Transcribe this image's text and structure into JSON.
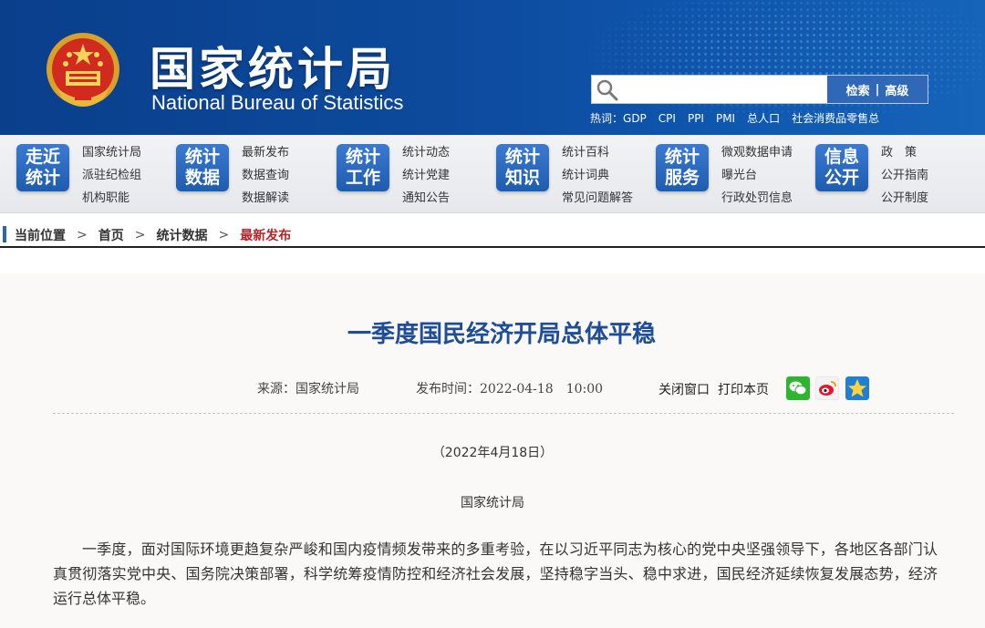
{
  "header": {
    "title": "国家统计局",
    "subtitle": "National Bureau of Statistics",
    "search": {
      "placeholder": "",
      "search_label": "检索",
      "separator": "|",
      "advanced_label": "高级"
    },
    "hotwords_label": "热词：",
    "hotwords": [
      "GDP",
      "CPI",
      "PPI",
      "PMI",
      "总人口",
      "社会消费品零售总"
    ]
  },
  "nav": [
    {
      "badge": [
        "走近",
        "统计"
      ],
      "links": [
        "国家统计局",
        "派驻纪检组",
        "机构职能"
      ]
    },
    {
      "badge": [
        "统计",
        "数据"
      ],
      "links": [
        "最新发布",
        "数据查询",
        "数据解读"
      ]
    },
    {
      "badge": [
        "统计",
        "工作"
      ],
      "links": [
        "统计动态",
        "统计党建",
        "通知公告"
      ]
    },
    {
      "badge": [
        "统计",
        "知识"
      ],
      "links": [
        "统计百科",
        "统计词典",
        "常见问题解答"
      ]
    },
    {
      "badge": [
        "统计",
        "服务"
      ],
      "links": [
        "微观数据申请",
        "曝光台",
        "行政处罚信息"
      ]
    },
    {
      "badge": [
        "信息",
        "公开"
      ],
      "links": [
        "政　策",
        "公开指南",
        "公开制度"
      ]
    }
  ],
  "breadcrumb": {
    "label": "当前位置",
    "items": [
      "首页",
      "统计数据",
      "最新发布"
    ],
    "separator": ">"
  },
  "article": {
    "title": "一季度国民经济开局总体平稳",
    "source": "来源：国家统计局",
    "publish_time": "发布时间：2022-04-18　10:00",
    "close_label": "关闭窗口",
    "print_label": "打印本页",
    "date_line": "（2022年4月18日）",
    "org_line": "国家统计局",
    "paragraph": "一季度，面对国际环境更趋复杂严峻和国内疫情频发带来的多重考验，在以习近平同志为核心的党中央坚强领导下，各地区各部门认真贯彻落实党中央、国务院决策部署，科学统筹疫情防控和经济社会发展，坚持稳字当头、稳中求进，国民经济延续恢复发展态势，经济运行总体平稳。"
  },
  "colors": {
    "header_blue": "#0d4a9c",
    "title_blue": "#1f4d96",
    "crumb_active": "#b3272a",
    "badge_blue": "#2b6bc2"
  },
  "icons": [
    "national-emblem",
    "search-icon",
    "wechat-icon",
    "weibo-icon",
    "favorite-star-icon"
  ]
}
